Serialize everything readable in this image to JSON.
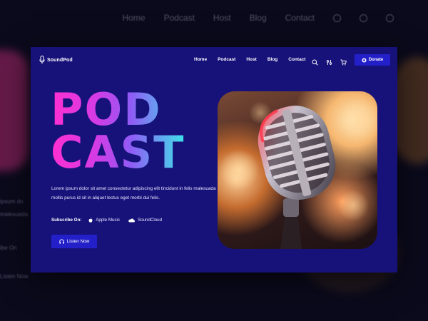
{
  "background": {
    "nav_items": [
      "Home",
      "Podcast",
      "Host",
      "Blog",
      "Contact"
    ],
    "text_fragments": [
      "ipsum do",
      "malesuada",
      "ibe On",
      "Listen Now"
    ]
  },
  "brand": {
    "name": "SoundPod",
    "icon": "microphone-icon"
  },
  "nav": {
    "items": [
      "Home",
      "Podcast",
      "Host",
      "Blog",
      "Contact"
    ],
    "icons": [
      "search-icon",
      "settings-icon",
      "cart-icon"
    ],
    "donate_label": "Donate",
    "donate_icon": "coin-icon"
  },
  "hero": {
    "title_line1": "POD",
    "title_line2": "CAST",
    "description": "Lorem ipsum dolor sit amet consectetur adipiscing elit tincidunt in felis malesuada mollis purus id sit in aliquet lectus eget morbi dui felis.",
    "subscribe_label": "Subscribe On:",
    "platforms": [
      {
        "name": "Apple Music",
        "icon": "apple-icon"
      },
      {
        "name": "SoundCloud",
        "icon": "cloud-icon"
      }
    ],
    "listen_label": "Listen Now",
    "listen_icon": "headphones-icon"
  },
  "colors": {
    "background": "#0b0a1c",
    "card": "#17117a",
    "button": "#2420c9",
    "gradient": [
      "#ff2fd0",
      "#8f5cf5",
      "#3ee3ea"
    ]
  }
}
